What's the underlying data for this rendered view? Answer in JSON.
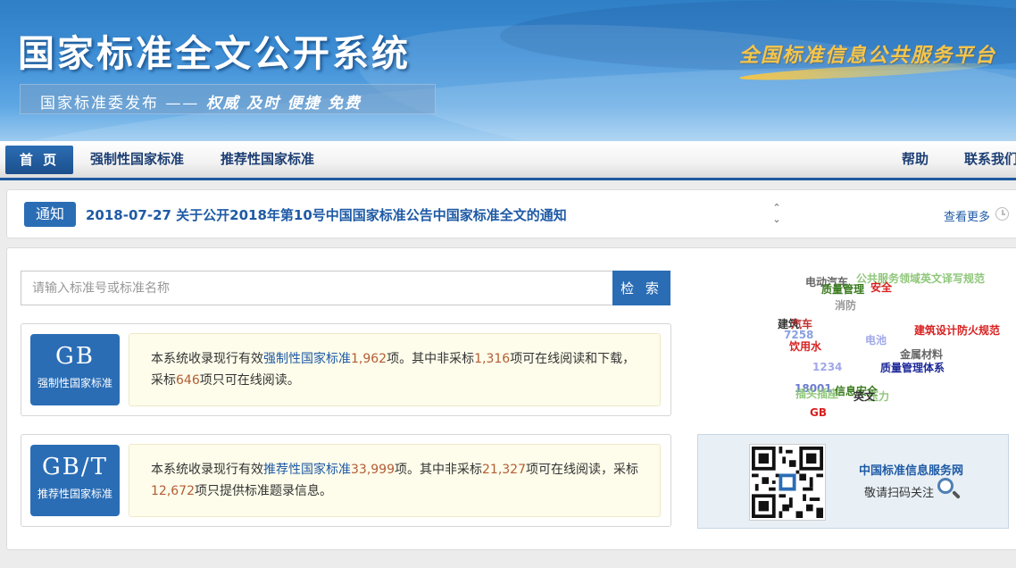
{
  "header": {
    "title": "国家标准全文公开系统",
    "slogan_prefix": "国家标准委发布",
    "slogan_dash": "——",
    "slogan_words": [
      "权威",
      "及时",
      "便捷",
      "免费"
    ],
    "platform": "全国标准信息公共服务平台"
  },
  "nav": {
    "home": "首 页",
    "mandatory": "强制性国家标准",
    "recommended": "推荐性国家标准",
    "help": "帮助",
    "contact": "联系我们"
  },
  "notice": {
    "tag": "通知",
    "text": "2018-07-27 关于公开2018年第10号中国国家标准公告中国家标准全文的通知",
    "more": "查看更多"
  },
  "search": {
    "placeholder": "请输入标准号或标准名称",
    "button": "检 索"
  },
  "cards": [
    {
      "code": "GB",
      "subtitle": "强制性国家标准",
      "t1": "本系统收录现行有效",
      "type": "强制性国家标准",
      "total": "1,962",
      "t2": "项。其中非采标",
      "online": "1,316",
      "t3": "项可在线阅读和下载，采标",
      "adopted": "646",
      "t4": "项只可在线阅读。"
    },
    {
      "code": "GB/T",
      "subtitle": "推荐性国家标准",
      "t1": "本系统收录现行有效",
      "type": "推荐性国家标准",
      "total": "33,999",
      "t2": "项。其中非采标",
      "online": "21,327",
      "t3": "项可在线阅读，采标",
      "adopted": "12,672",
      "t4": "项只提供标准题录信息。"
    }
  ],
  "tag_cloud": [
    {
      "text": "电动汽车",
      "color": "#666666"
    },
    {
      "text": "公共服务领域英文译写规范",
      "color": "#8fc77a"
    },
    {
      "text": "质量管理",
      "color": "#3a7a1e"
    },
    {
      "text": "安全",
      "color": "#d82020"
    },
    {
      "text": "消防",
      "color": "#999999"
    },
    {
      "text": "建筑",
      "color": "#333333"
    },
    {
      "text": "汽车",
      "color": "#c03030"
    },
    {
      "text": "7258",
      "color": "#8aa0e0"
    },
    {
      "text": "饮用水",
      "color": "#d82020"
    },
    {
      "text": "电池",
      "color": "#a0a8e8"
    },
    {
      "text": "建筑设计防火规范",
      "color": "#d82020"
    },
    {
      "text": "金属材料",
      "color": "#666666"
    },
    {
      "text": "1234",
      "color": "#a0a8e8"
    },
    {
      "text": "质量管理体系",
      "color": "#1e2a9a"
    },
    {
      "text": "18001",
      "color": "#6a7ad0"
    },
    {
      "text": "插头插座",
      "color": "#8fc77a"
    },
    {
      "text": "信息安全",
      "color": "#3a7a1e"
    },
    {
      "text": "压力",
      "color": "#8fc77a"
    },
    {
      "text": "英文",
      "color": "#333333"
    },
    {
      "text": "GB",
      "color": "#d82020"
    }
  ],
  "qr": {
    "title": "中国标准信息服务网",
    "subtitle": "敬请扫码关注"
  }
}
